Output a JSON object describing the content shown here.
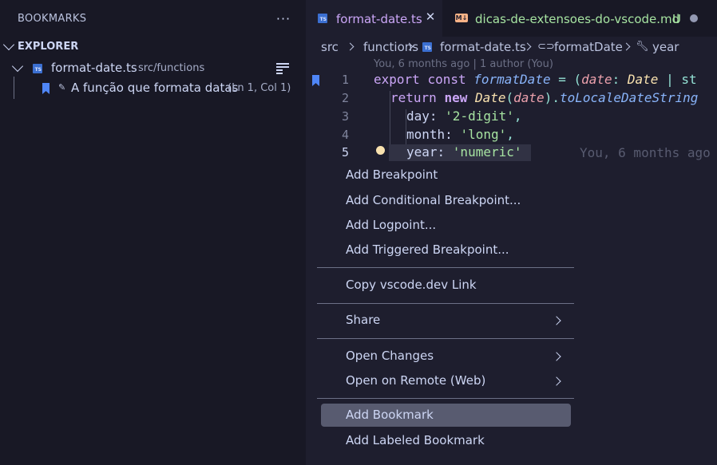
{
  "sidebar": {
    "title": "BOOKMARKS",
    "more_icon": "ellipsis-icon",
    "section_label": "EXPLORER",
    "file": {
      "name": "format-date.ts",
      "path": "src/functions",
      "icon": "typescript-file-icon"
    },
    "bookmark": {
      "label": "A função que formata datas",
      "position": "(Ln 1, Col 1)"
    }
  },
  "tabs": [
    {
      "label": "format-date.ts",
      "active": true,
      "icon": "typescript-file-icon",
      "badge": "TS"
    },
    {
      "label": "dicas-de-extensoes-do-vscode.md",
      "active": false,
      "icon": "markdown-file-icon",
      "badge": "M↓",
      "status": "U"
    }
  ],
  "breadcrumb": [
    "src",
    "functions",
    "format-date.ts",
    "formatDate",
    "year"
  ],
  "editor": {
    "blame_header": "You, 6 months ago | 1 author (You)",
    "line_numbers": [
      "1",
      "2",
      "3",
      "4",
      "5"
    ],
    "code": {
      "l1_export": "export",
      "l1_const": "const",
      "l1_fn": "formatDate",
      "l1_eq": " = (",
      "l1_param": "date",
      "l1_colon": ": ",
      "l1_type": "Date",
      "l1_tail": " | st",
      "l2_return": "return",
      "l2_new": "new",
      "l2_class": "Date",
      "l2_paren": "(",
      "l2_param": "date",
      "l2_close": ").",
      "l2_method": "toLocaleDateString",
      "l3_key": "day: ",
      "l3_val": "'2-digit'",
      "l3_comma": ",",
      "l4_key": "month: ",
      "l4_val": "'long'",
      "l4_comma": ",",
      "l5_key": "year: ",
      "l5_val": "'numeric'"
    },
    "inline_blame": "You, 6 months ago"
  },
  "context_menu": {
    "groups": [
      [
        "Add Breakpoint",
        "Add Conditional Breakpoint...",
        "Add Logpoint...",
        "Add Triggered Breakpoint..."
      ],
      [
        "Copy vscode.dev Link"
      ],
      [
        "Share"
      ],
      [
        "Open Changes",
        "Open on Remote (Web)"
      ],
      [
        "Add Bookmark",
        "Add Labeled Bookmark"
      ]
    ],
    "highlighted": "Add Bookmark"
  },
  "colors": {
    "background": "#1e1e2e",
    "sidebar": "#181825",
    "accent_purple": "#cba6f7",
    "bookmark_blue": "#4f86f7",
    "untracked_green": "#a6e3a1",
    "menu_hover": "#585b70"
  }
}
